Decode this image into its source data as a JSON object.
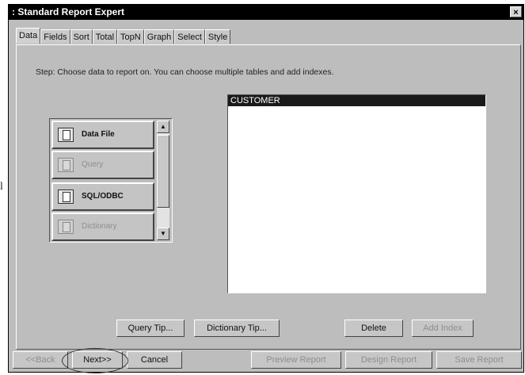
{
  "page": {
    "stray_char": "l"
  },
  "window": {
    "title": ": Standard Report Expert",
    "close_label": "×"
  },
  "tabs": [
    {
      "label": "Data",
      "active": true
    },
    {
      "label": "Fields"
    },
    {
      "label": "Sort"
    },
    {
      "label": "Total"
    },
    {
      "label": "TopN"
    },
    {
      "label": "Graph"
    },
    {
      "label": "Select"
    },
    {
      "label": "Style"
    }
  ],
  "step_text": "Step: Choose data to report on. You can choose multiple tables and add indexes.",
  "data_sources": [
    {
      "label": "Data File",
      "icon": "data-file-icon",
      "enabled": true
    },
    {
      "label": "Query",
      "icon": "query-icon",
      "enabled": false
    },
    {
      "label": "SQL/ODBC",
      "icon": "sql-odbc-icon",
      "enabled": true
    },
    {
      "label": "Dictionary",
      "icon": "dictionary-icon",
      "enabled": false
    }
  ],
  "scrollbar": {
    "up_arrow": "▲",
    "down_arrow": "▼"
  },
  "tables_list": {
    "items": [
      {
        "label": "CUSTOMER",
        "selected": true
      }
    ]
  },
  "panel_buttons": {
    "query_tip": "Query Tip...",
    "dictionary_tip": "Dictionary Tip...",
    "delete": "Delete",
    "add_index": "Add Index"
  },
  "bottom_buttons": {
    "back": "<<Back",
    "next": "Next>>",
    "cancel": "Cancel",
    "preview": "Preview Report",
    "design": "Design Report",
    "save": "Save Report"
  },
  "colors": {
    "window_bg": "#bdbdbd",
    "title_bg": "#000000",
    "selection_bg": "#1a1a1a"
  }
}
